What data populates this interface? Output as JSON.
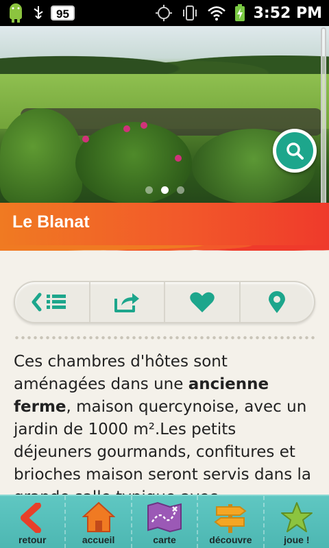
{
  "status_bar": {
    "battery_level": "95",
    "time": "3:52 PM"
  },
  "hero": {
    "slides_count": 3,
    "active_slide": 2
  },
  "place": {
    "title": "Le Blanat"
  },
  "actions": {
    "items": [
      "back-to-list",
      "share",
      "favorite",
      "locate"
    ]
  },
  "description": {
    "part1": "Ces chambres d'hôtes sont aménagées dans une ",
    "bold": "ancienne ferme",
    "part2": ", maison quercynoise, avec un jardin de 1000 m².Les petits déjeuners gourmands, confitures et brioches maison seront servis dans la grande salle typique avec"
  },
  "bottom_nav": {
    "items": [
      {
        "label": "retour",
        "icon": "back-chevron-icon"
      },
      {
        "label": "accueil",
        "icon": "home-icon"
      },
      {
        "label": "carte",
        "icon": "map-icon"
      },
      {
        "label": "découvre",
        "icon": "signpost-icon"
      },
      {
        "label": "joue !",
        "icon": "star-icon"
      }
    ]
  },
  "colors": {
    "accent_teal": "#1da68c",
    "title_orange": "#f07a22",
    "title_red": "#ef3a2b",
    "nav_teal": "#5fc7c2"
  }
}
